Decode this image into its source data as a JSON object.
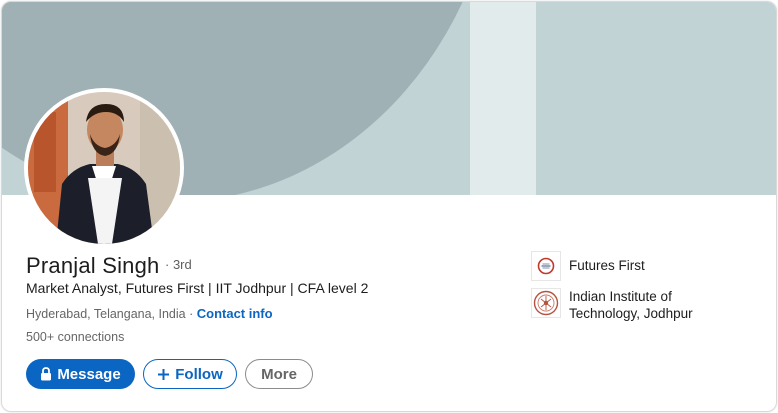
{
  "profile": {
    "name": "Pranjal Singh",
    "degree": "· 3rd",
    "headline": "Market Analyst, Futures First | IIT Jodhpur | CFA level 2",
    "location": "Hyderabad, Telangana, India",
    "separator": " · ",
    "contact_info": "Contact info",
    "connections": "500+ connections"
  },
  "actions": {
    "message": "Message",
    "follow": "Follow",
    "more": "More"
  },
  "organizations": [
    {
      "name": "Futures First",
      "logo": "futures-first-logo"
    },
    {
      "name": "Indian Institute of Technology, Jodhpur",
      "logo": "iit-jodhpur-logo"
    }
  ],
  "colors": {
    "accent": "#0a66c2",
    "banner_light": "#c2d3d6",
    "banner_dark": "#9fb1b4"
  }
}
